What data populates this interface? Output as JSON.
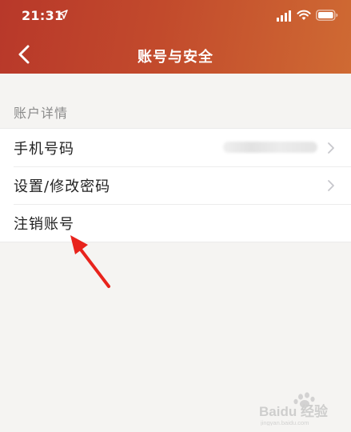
{
  "status_bar": {
    "time": "21:31",
    "location_icon": "location-arrow-icon",
    "signal_icon": "cellular-signal-icon",
    "wifi_icon": "wifi-icon",
    "battery_icon": "battery-icon"
  },
  "nav": {
    "back_icon": "chevron-left-icon",
    "title": "账号与安全"
  },
  "section": {
    "label": "账户详情"
  },
  "rows": [
    {
      "label": "手机号码",
      "value": "",
      "has_chevron": true
    },
    {
      "label": "设置/修改密码",
      "has_chevron": true
    },
    {
      "label": "注销账号",
      "has_chevron": false
    }
  ],
  "annotation": {
    "arrow_color": "#e8231c",
    "points_to": "注销账号"
  },
  "watermark": {
    "brand": "Baidu经验",
    "url": "jingyan.baidu.com"
  },
  "colors": {
    "header_start": "#b8382a",
    "header_end": "#cf6a33",
    "background": "#f5f4f2",
    "row_background": "#ffffff"
  }
}
